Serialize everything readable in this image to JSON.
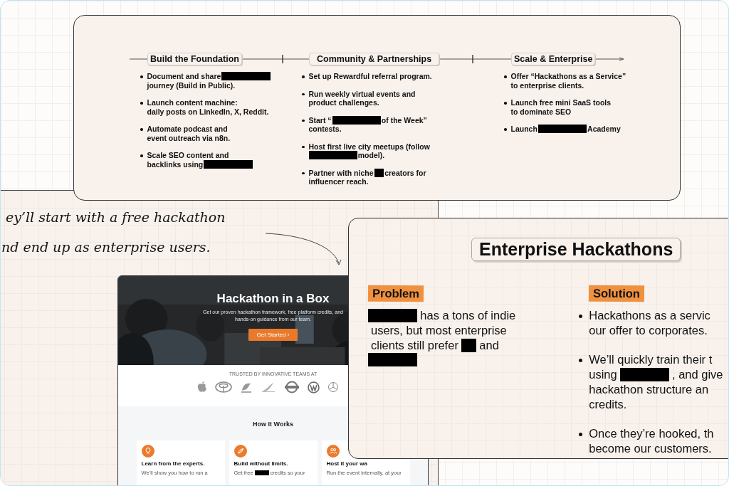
{
  "roadmap": {
    "stages": [
      {
        "title": "Build the Foundation",
        "items": [
          {
            "lines": [
              [
                {
                  "kind": "text",
                  "text": "Document and share"
                },
                {
                  "kind": "redacted"
                }
              ],
              [
                {
                  "kind": "text",
                  "text": "journey (Build in Public)."
                }
              ]
            ]
          },
          {
            "lines": [
              [
                {
                  "kind": "text",
                  "text": "Launch content machine:"
                }
              ],
              [
                {
                  "kind": "text",
                  "text": "daily posts on LinkedIn, X, Reddit."
                }
              ]
            ]
          },
          {
            "lines": [
              [
                {
                  "kind": "text",
                  "text": "Automate podcast and"
                }
              ],
              [
                {
                  "kind": "text",
                  "text": "event outreach via n8n."
                }
              ]
            ]
          },
          {
            "lines": [
              [
                {
                  "kind": "text",
                  "text": "Scale SEO content and"
                }
              ],
              [
                {
                  "kind": "text",
                  "text": "backlinks using"
                },
                {
                  "kind": "redacted"
                }
              ]
            ]
          }
        ]
      },
      {
        "title": "Community & Partnerships",
        "items": [
          {
            "lines": [
              [
                {
                  "kind": "text",
                  "text": "Set up Rewardful referral program."
                }
              ]
            ]
          },
          {
            "lines": [
              [
                {
                  "kind": "text",
                  "text": "Run weekly virtual events and"
                }
              ],
              [
                {
                  "kind": "text",
                  "text": "product challenges."
                }
              ]
            ]
          },
          {
            "lines": [
              [
                {
                  "kind": "text",
                  "text": "Start “"
                },
                {
                  "kind": "redacted"
                },
                {
                  "kind": "text",
                  "text": "of the Week”"
                }
              ],
              [
                {
                  "kind": "text",
                  "text": "contests."
                }
              ]
            ]
          },
          {
            "lines": [
              [
                {
                  "kind": "text",
                  "text": "Host first live city meetups (follow"
                }
              ],
              [
                {
                  "kind": "redacted"
                },
                {
                  "kind": "text",
                  "text": "model)."
                }
              ]
            ]
          },
          {
            "lines": [
              [
                {
                  "kind": "text",
                  "text": "Partner with niche"
                },
                {
                  "kind": "redacted-short"
                },
                {
                  "kind": "text",
                  "text": "creators for"
                }
              ],
              [
                {
                  "kind": "text",
                  "text": "influencer reach."
                }
              ]
            ]
          }
        ]
      },
      {
        "title": "Scale & Enterprise",
        "items": [
          {
            "lines": [
              [
                {
                  "kind": "text",
                  "text": "Offer “Hackathons as a Service”"
                }
              ],
              [
                {
                  "kind": "text",
                  "text": "to enterprise clients."
                }
              ]
            ]
          },
          {
            "lines": [
              [
                {
                  "kind": "text",
                  "text": "Launch free mini SaaS tools"
                }
              ],
              [
                {
                  "kind": "text",
                  "text": "to dominate SEO"
                }
              ]
            ]
          },
          {
            "lines": [
              [
                {
                  "kind": "text",
                  "text": "Launch"
                },
                {
                  "kind": "redacted"
                },
                {
                  "kind": "text",
                  "text": "Academy"
                }
              ]
            ]
          }
        ]
      }
    ]
  },
  "note": {
    "lines": [
      "ey’ll start with a free hackathon",
      "nd end up as enterprise users."
    ]
  },
  "website": {
    "hero": {
      "title": "Hackathon in a Box",
      "subtitle": "Get our proven hackathon framework, free platform credits, and hands-on guidance from our team.",
      "button": "Get Started  ›"
    },
    "trusted": "TRUSTED BY INNOVATIVE TEAMS AT",
    "how_title": "How It Works",
    "steps": [
      {
        "title": "Learn from the experts.",
        "text": [
          {
            "kind": "text",
            "text": "We’ll show you how to run a"
          }
        ]
      },
      {
        "title": "Build without limits.",
        "text": [
          {
            "kind": "text",
            "text": "Get free"
          },
          {
            "kind": "redacted"
          },
          {
            "kind": "text",
            "text": "credits so your"
          }
        ]
      },
      {
        "title": "Host it your wa",
        "text": [
          {
            "kind": "text",
            "text": "Run the event internally, at your"
          }
        ]
      }
    ]
  },
  "enterprise": {
    "title": "Enterprise Hackathons",
    "problem": {
      "label": "Problem",
      "lines": [
        [
          {
            "kind": "redacted"
          },
          {
            "kind": "text",
            "text": "has a tons of indie"
          }
        ],
        [
          {
            "kind": "text",
            "text": "users, but most enterprise"
          }
        ],
        [
          {
            "kind": "text",
            "text": "clients still prefer"
          },
          {
            "kind": "redacted-short"
          },
          {
            "kind": "text",
            "text": "and"
          }
        ],
        [
          {
            "kind": "redacted"
          }
        ]
      ]
    },
    "solution": {
      "label": "Solution",
      "items": [
        {
          "lines": [
            [
              {
                "kind": "text",
                "text": "Hackathons as a servic"
              }
            ],
            [
              {
                "kind": "text",
                "text": "our offer to corporates."
              }
            ]
          ]
        },
        {
          "lines": [
            [
              {
                "kind": "text",
                "text": "We’ll quickly train their t"
              }
            ],
            [
              {
                "kind": "text",
                "text": "using"
              },
              {
                "kind": "redacted"
              },
              {
                "kind": "text",
                "text": ", and give"
              }
            ],
            [
              {
                "kind": "text",
                "text": "hackathon structure an"
              }
            ],
            [
              {
                "kind": "text",
                "text": "credits."
              }
            ]
          ]
        },
        {
          "lines": [
            [
              {
                "kind": "text",
                "text": "Once they’re hooked, th"
              }
            ],
            [
              {
                "kind": "text",
                "text": "become our customers."
              }
            ]
          ]
        }
      ]
    }
  }
}
